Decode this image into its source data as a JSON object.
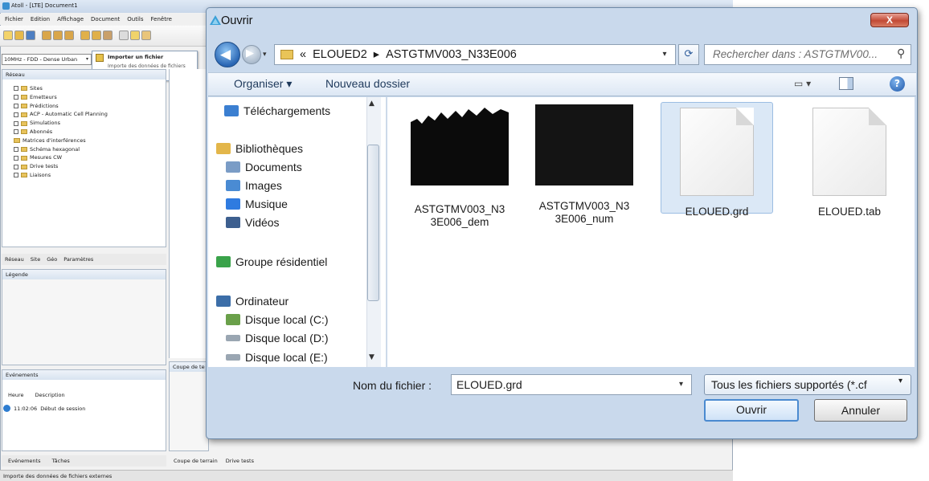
{
  "app": {
    "title": "Atoll - [LTE] Document1",
    "menu": [
      "Fichier",
      "Edition",
      "Affichage",
      "Document",
      "Outils",
      "Fenêtre"
    ],
    "technology": "10MHz - FDD - Dense Urban",
    "import_menu": {
      "title": "Importer un fichier",
      "description": "Importe des données de fichiers externes"
    },
    "reseau_panel": {
      "title": "Réseau",
      "items": [
        "Sites",
        "Emetteurs",
        "Prédictions",
        "ACP - Automatic Cell Planning",
        "Simulations",
        "Abonnés",
        "Matrices d'interférences",
        "Schéma hexagonal",
        "Mesures CW",
        "Drive tests",
        "Liaisons"
      ]
    },
    "panel_tabs": [
      "Réseau",
      "Site",
      "Géo",
      "Paramètres"
    ],
    "legende_title": "Légende",
    "events": {
      "title": "Evénements",
      "columns": [
        "Heure",
        "Description"
      ],
      "rows": [
        {
          "time": "11:02:06",
          "desc": "Début de session"
        }
      ]
    },
    "bottom_tabs": [
      "Evénements",
      "Tâches"
    ],
    "bottom_tabs2": [
      "Coupe de terrain",
      "Drive tests"
    ],
    "coupe_title": "Coupe de te",
    "status": "Importe des données de fichiers externes"
  },
  "dialog": {
    "title": "Ouvrir",
    "close": "X",
    "breadcrumb": [
      "«",
      "ELOUED2",
      "▸",
      "ASTGTMV003_N33E006"
    ],
    "search_placeholder": "Rechercher dans : ASTGTMV00...",
    "toolbar": {
      "organiser": "Organiser ▾",
      "nouveau_dossier": "Nouveau dossier"
    },
    "nav": [
      {
        "label": "Téléchargements",
        "icon": "downloads-folder-icon",
        "color": "#3b7fd1"
      },
      {
        "label": "Bibliothèques",
        "icon": "libraries-icon",
        "color": "#e3b64a"
      },
      {
        "label": "Documents",
        "icon": "documents-icon",
        "color": "#7a9cc6"
      },
      {
        "label": "Images",
        "icon": "images-icon",
        "color": "#4a8bd3"
      },
      {
        "label": "Musique",
        "icon": "music-icon",
        "color": "#2f7be0"
      },
      {
        "label": "Vidéos",
        "icon": "videos-icon",
        "color": "#3d5f8f"
      },
      {
        "label": "Groupe résidentiel",
        "icon": "homegroup-icon",
        "color": "#3aa34a"
      },
      {
        "label": "Ordinateur",
        "icon": "computer-icon",
        "color": "#3c6ea8"
      },
      {
        "label": "Disque local (C:)",
        "icon": "drive-c-icon",
        "color": "#6aa04a"
      },
      {
        "label": "Disque local (D:)",
        "icon": "drive-d-icon",
        "color": "#9aa6b2"
      },
      {
        "label": "Disque local (E:)",
        "icon": "drive-e-icon",
        "color": "#9aa6b2"
      }
    ],
    "files": [
      {
        "line1": "ASTGTMV003_N3",
        "line2": "3E006_dem",
        "kind": "image"
      },
      {
        "line1": "ASTGTMV003_N3",
        "line2": "3E006_num",
        "kind": "image"
      },
      {
        "line1": "ELOUED.grd",
        "line2": "",
        "kind": "document",
        "selected": true
      },
      {
        "line1": "ELOUED.tab",
        "line2": "",
        "kind": "document"
      }
    ],
    "filename_label": "Nom du fichier :",
    "filename_value": "ELOUED.grd",
    "filter": "Tous les fichiers supportés (*.cf",
    "open": "Ouvrir",
    "cancel": "Annuler"
  }
}
